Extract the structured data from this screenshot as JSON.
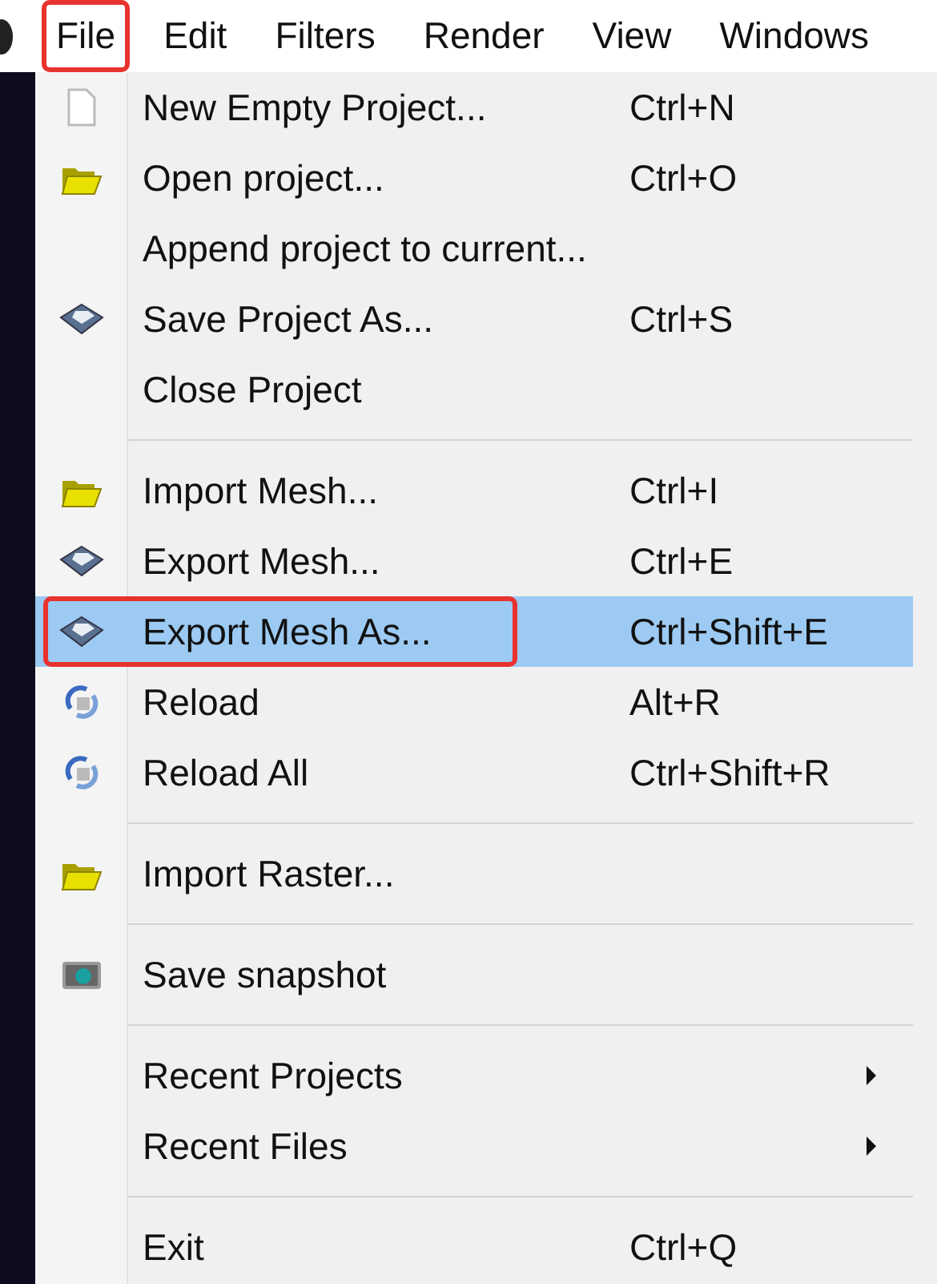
{
  "menu_bar": [
    {
      "label": "File",
      "annotated": true
    },
    {
      "label": "Edit",
      "annotated": false
    },
    {
      "label": "Filters",
      "annotated": false
    },
    {
      "label": "Render",
      "annotated": false
    },
    {
      "label": "View",
      "annotated": false
    },
    {
      "label": "Windows",
      "annotated": false
    }
  ],
  "file_menu": [
    {
      "kind": "item",
      "label": "New Empty Project...",
      "shortcut": "Ctrl+N",
      "selected": false,
      "annotated": false
    },
    {
      "kind": "item",
      "label": "Open project...",
      "shortcut": "Ctrl+O",
      "selected": false,
      "annotated": false
    },
    {
      "kind": "item",
      "label": "Append project to current...",
      "selected": false,
      "annotated": false
    },
    {
      "kind": "item",
      "label": "Save Project As...",
      "shortcut": "Ctrl+S",
      "selected": false,
      "annotated": false
    },
    {
      "kind": "item",
      "label": "Close Project",
      "selected": false,
      "annotated": false
    },
    {
      "kind": "separator"
    },
    {
      "kind": "item",
      "label": "Import Mesh...",
      "shortcut": "Ctrl+I",
      "selected": false,
      "annotated": false
    },
    {
      "kind": "item",
      "label": "Export Mesh...",
      "shortcut": "Ctrl+E",
      "selected": false,
      "annotated": false
    },
    {
      "kind": "item",
      "label": "Export Mesh As...",
      "shortcut": "Ctrl+Shift+E",
      "selected": true,
      "annotated": true
    },
    {
      "kind": "item",
      "label": "Reload",
      "shortcut": "Alt+R",
      "selected": false,
      "annotated": false
    },
    {
      "kind": "item",
      "label": "Reload All",
      "shortcut": "Ctrl+Shift+R",
      "selected": false,
      "annotated": false
    },
    {
      "kind": "separator"
    },
    {
      "kind": "item",
      "label": "Import Raster...",
      "selected": false,
      "annotated": false
    },
    {
      "kind": "separator"
    },
    {
      "kind": "item",
      "label": "Save snapshot",
      "selected": false,
      "annotated": false
    },
    {
      "kind": "separator"
    },
    {
      "kind": "submenu",
      "label": "Recent Projects",
      "selected": false,
      "annotated": false
    },
    {
      "kind": "submenu",
      "label": "Recent Files",
      "selected": false,
      "annotated": false
    },
    {
      "kind": "separator"
    },
    {
      "kind": "item",
      "label": "Exit",
      "shortcut": "Ctrl+Q",
      "selected": false,
      "annotated": false
    }
  ]
}
